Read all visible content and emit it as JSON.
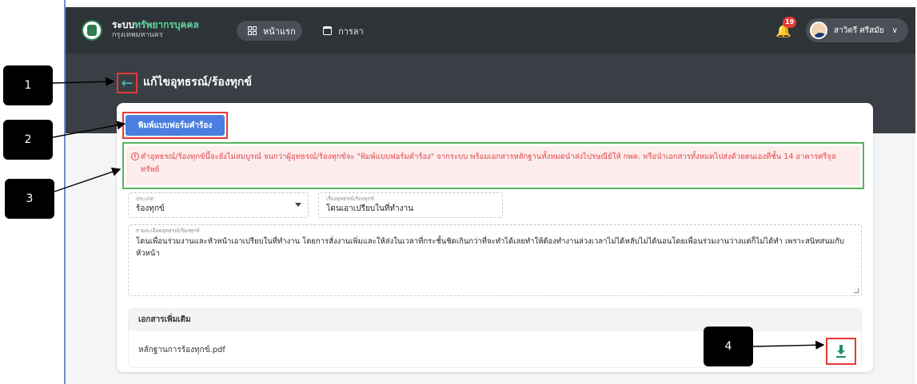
{
  "app": {
    "title_prefix": "ระบบ",
    "title_accent": "ทรัพยากรบุคคล",
    "subtitle": "กรุงเทพมหานคร"
  },
  "nav": {
    "home": "หน้าแรก",
    "leave": "การลา"
  },
  "notifications": {
    "count": "19"
  },
  "user": {
    "name": "สาวิตรี ศรีสมัย"
  },
  "page": {
    "title": "แก้ไขอุทธรณ์/ร้องทุกข์"
  },
  "form": {
    "print_button": "พิมพ์แบบฟอร์มคำร้อง",
    "warning": "คำอุทธรณ์/ร้องทุกข์นี้จะยังไม่สมบูรณ์ จนกว่าผู้อุทธรณ์/ร้องทุกข์จะ \"พิมพ์แบบฟอร์มคำร้อง\" จากระบบ พร้อมเอกสารหลักฐานทั้งหมดนำส่งไปรษณีย์ให้ กพค. หรือนำเอกสารทั้งหมดไปส่งด้วยตนเองที่ชั้น 14 อาคารศรีจุลทรัพย์",
    "type_label": "ประเภท",
    "type_value": "ร้องทุกข์",
    "subject_label": "เรื่องอุทธรณ์/ร้องทุกข์",
    "subject_value": "โดนเอาเปรียบในที่ทำงาน",
    "detail_label": "รายละเอียดอุทธรณ์/ร้องทุกข์",
    "detail_value": "โดนเพื่อนร่วมงานและหัวหน้าเอาเปรียบในที่ทำงาน โดยการสั่งงานเพิ่มและให้ส่งในเวลาที่กระชั้นชิดเกินกว่าที่จะทำได้เลยทำให้ต้องทำงานล่วงเวลาไม่ได้หลับไม่ได้นอนโดยเพื่อนร่วมงานว่างแต่ก็ไม่ได้ทำ เพราะสนิทสนมกับหัวหน้า"
  },
  "documents": {
    "heading": "เอกสารเพิ่มเติม",
    "file_name": "หลักฐานการร้องทุกข์.pdf"
  },
  "callouts": [
    "1",
    "2",
    "3",
    "4"
  ],
  "colors": {
    "topbar": "#2e3338",
    "accent_green": "#5fd39b",
    "print_button": "#4a7ee0",
    "warning_text": "#e0474c",
    "warning_bg": "#fdecec",
    "highlight_red": "#e53935",
    "highlight_green": "#57b35c",
    "download_icon": "#1e8e6e"
  }
}
